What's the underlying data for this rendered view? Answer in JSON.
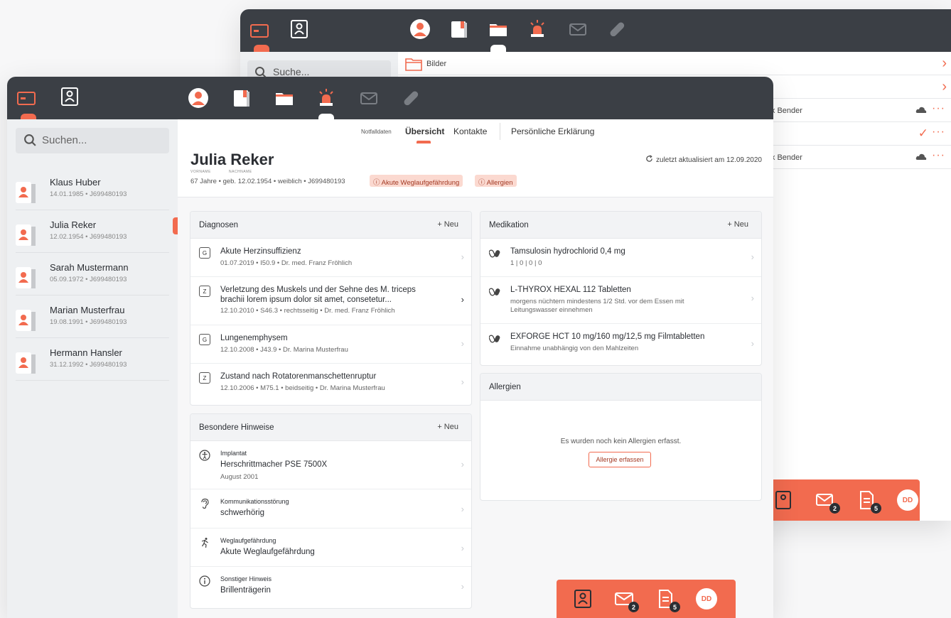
{
  "back_window": {
    "search_placeholder": "Suche...",
    "rows": [
      {
        "label": "Bilder",
        "author": "",
        "status": "chevron"
      },
      {
        "label": "",
        "author": "",
        "status": "chevron"
      },
      {
        "label": "",
        "author": "lix Bender",
        "status": "cloud"
      },
      {
        "label": "",
        "author": "",
        "status": "check"
      },
      {
        "label": "",
        "author": "lix Bender",
        "status": "cloud"
      }
    ],
    "bottombar": {
      "mail_count": "2",
      "docs_count": "5",
      "avatar": "DD"
    }
  },
  "front_window": {
    "search_placeholder": "Suchen...",
    "patients": [
      {
        "name": "Klaus Huber",
        "meta": "14.01.1985 • J699480193"
      },
      {
        "name": "Julia Reker",
        "meta": "12.02.1954 • J699480193"
      },
      {
        "name": "Sarah Mustermann",
        "meta": "05.09.1972 • J699480193"
      },
      {
        "name": "Marian Musterfrau",
        "meta": "19.08.1991 • J699480193"
      },
      {
        "name": "Hermann Hansler",
        "meta": "31.12.1992 • J699480193"
      }
    ],
    "subnav": {
      "notfalldaten": "Notfalldaten",
      "uebersicht": "Übersicht",
      "kontakte": "Kontakte",
      "erklaerung": "Persönliche Erklärung"
    },
    "header": {
      "name": "Julia Reker",
      "vorname_label": "VORNAME",
      "nachname_label": "NACHNAME",
      "meta": "67 Jahre • geb. 12.02.1954 • weiblich • J699480193",
      "badge1": "ⓘ Akute Weglaufgefährdung",
      "badge2": "ⓘ Allergien",
      "updated": "zuletzt aktualisiert am 12.09.2020"
    },
    "diagnosen": {
      "title": "Diagnosen",
      "new": "+ Neu",
      "items": [
        {
          "chip": "G",
          "title": "Akute Herzinsuffizienz",
          "title2": "",
          "meta": "01.07.2019 • I50.9 • Dr. med. Franz Fröhlich"
        },
        {
          "chip": "Z",
          "title": "Verletzung des Muskels und der Sehne des M. triceps",
          "title2": "brachii lorem ipsum dolor sit amet, consetetur...",
          "meta": "12.10.2010 • S46.3 • rechtsseitig • Dr. med. Franz Fröhlich"
        },
        {
          "chip": "G",
          "title": "Lungenemphysem",
          "title2": "",
          "meta": "12.10.2008 • J43.9 • Dr. Marina Musterfrau"
        },
        {
          "chip": "Z",
          "title": "Zustand nach Rotatorenmanschettenruptur",
          "title2": "",
          "meta": "12.10.2006 • M75.1 • beidseitig • Dr. Marina Musterfrau"
        }
      ]
    },
    "hinweise": {
      "title": "Besondere Hinweise",
      "new": "+ Neu",
      "items": [
        {
          "label": "Implantat",
          "value": "Herschrittmacher PSE 7500X",
          "sub": "August 2001"
        },
        {
          "label": "Kommunikationsstörung",
          "value": "schwerhörig",
          "sub": ""
        },
        {
          "label": "Weglaufgefährdung",
          "value": "Akute Weglaufgefährdung",
          "sub": ""
        },
        {
          "label": "Sonstiger Hinweis",
          "value": "Brillenträgerin",
          "sub": ""
        }
      ]
    },
    "medikation": {
      "title": "Medikation",
      "new": "+ Neu",
      "items": [
        {
          "title": "Tamsulosin hydrochlorid 0,4 mg",
          "line1": "1 | 0 | 0 | 0",
          "line2": ""
        },
        {
          "title": "L-THYROX HEXAL 112 Tabletten",
          "line1": "morgens nüchtern mindestens 1/2 Std. vor dem Essen mit",
          "line2": "Leitungswasser einnehmen"
        },
        {
          "title": "EXFORGE HCT 10 mg/160 mg/12,5 mg Filmtabletten",
          "line1": "Einnahme unabhängig von den Mahlzeiten",
          "line2": ""
        }
      ]
    },
    "allergien": {
      "title": "Allergien",
      "empty": "Es wurden noch kein Allergien erfasst.",
      "button": "Allergie erfassen"
    },
    "bottombar": {
      "mail_count": "2",
      "docs_count": "5",
      "avatar": "DD"
    }
  },
  "colors": {
    "accent": "#f26b4f",
    "topbar": "#3b3f45",
    "sidebar": "#eef0f2"
  }
}
